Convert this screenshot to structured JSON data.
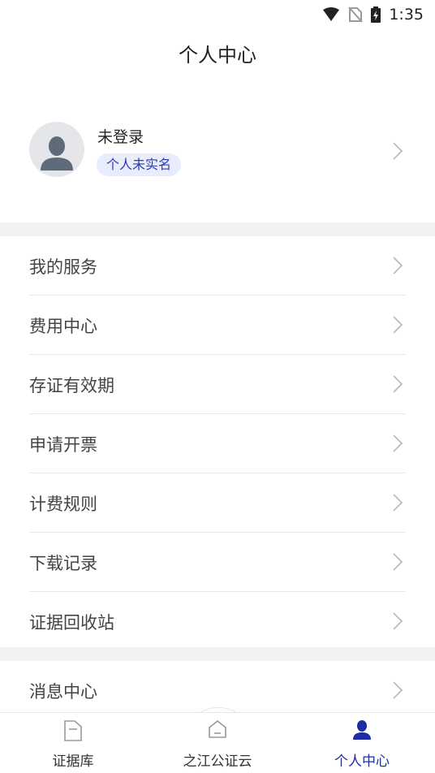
{
  "status_bar": {
    "time": "1:35"
  },
  "header": {
    "title": "个人中心"
  },
  "profile": {
    "name": "未登录",
    "badge": "个人未实名"
  },
  "menu_group_1": [
    {
      "label": "我的服务"
    },
    {
      "label": "费用中心"
    },
    {
      "label": "存证有效期"
    },
    {
      "label": "申请开票"
    },
    {
      "label": "计费规则"
    },
    {
      "label": "下载记录"
    },
    {
      "label": "证据回收站"
    }
  ],
  "menu_group_2": [
    {
      "label": "消息中心"
    }
  ],
  "tabbar": {
    "tabs": [
      {
        "label": "证据库",
        "icon": "folder-icon"
      },
      {
        "label": "之江公证云",
        "icon": "home-icon"
      },
      {
        "label": "个人中心",
        "icon": "person-icon",
        "active": true
      }
    ]
  },
  "colors": {
    "accent": "#1e2ea0",
    "badge_bg": "#e9ecfb",
    "band": "#f2f2f2"
  }
}
